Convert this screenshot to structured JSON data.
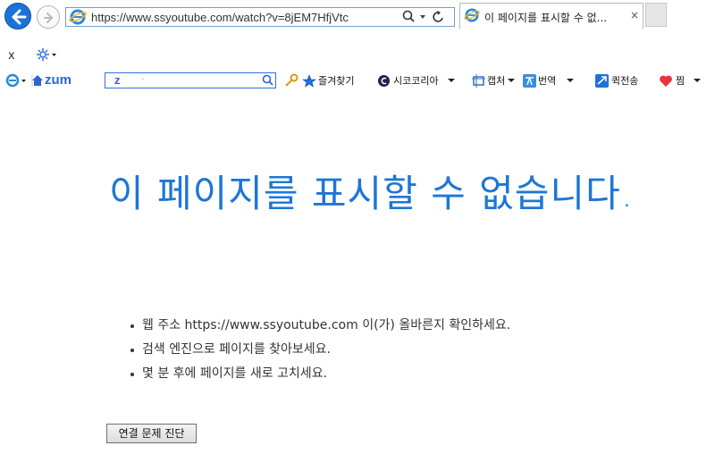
{
  "browser": {
    "address_url": "https://www.ssyoutube.com/watch?v=8jEM7HfjVtc",
    "tab_title": "이 페이지를 표시할 수 없...",
    "tab_close": "×",
    "secondary_close": "x",
    "icons": [
      "back-arrow-icon",
      "forward-arrow-icon",
      "ie-logo-icon",
      "search-icon",
      "dropdown-icon",
      "refresh-icon",
      "close-icon",
      "gear-icon"
    ]
  },
  "toolbar": {
    "zum_logo": "zum",
    "zum_search_value": "z",
    "zum_search_dot": "·",
    "items": [
      {
        "label": "즐겨찾기",
        "icon": "star-icon"
      },
      {
        "label": "시코코리아",
        "icon": "c-logo-icon"
      },
      {
        "label": "캡처",
        "icon": "capture-icon"
      },
      {
        "label": "번역",
        "icon": "translate-icon"
      },
      {
        "label": "퀵전송",
        "icon": "quick-send-icon"
      },
      {
        "label": "찜",
        "icon": "heart-icon"
      }
    ]
  },
  "error": {
    "heading": "이 페이지를 표시할 수 없습니다.",
    "tips": [
      "웹 주소 https://www.ssyoutube.com 이(가) 올바른지 확인하세요.",
      "검색 엔진으로 페이지를 찾아보세요.",
      "몇 분 후에 페이지를 새로 고치세요."
    ],
    "diagnose_button": "연결 문제 진단"
  },
  "colors": {
    "heading": "#1e76d6",
    "back_button": "#1a73d9",
    "zum_brand": "#2e63d6"
  }
}
